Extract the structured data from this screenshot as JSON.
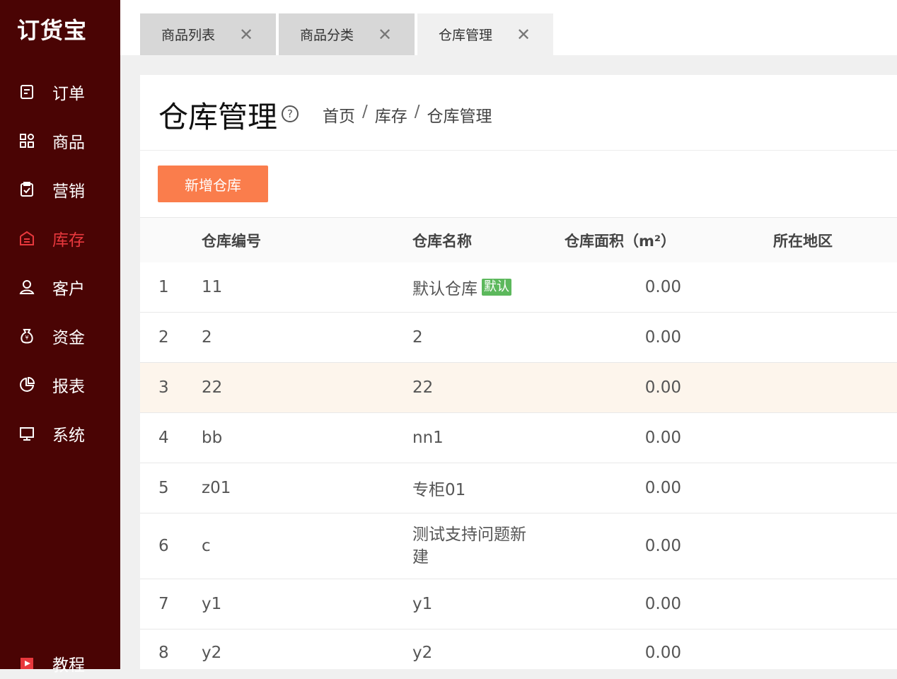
{
  "app": {
    "logo": "订货宝"
  },
  "sidebar": {
    "items": [
      {
        "label": "订单",
        "icon": "order-icon",
        "active": false
      },
      {
        "label": "商品",
        "icon": "grid-icon",
        "active": false
      },
      {
        "label": "营销",
        "icon": "clipboard-check-icon",
        "active": false
      },
      {
        "label": "库存",
        "icon": "warehouse-icon",
        "active": true
      },
      {
        "label": "客户",
        "icon": "user-icon",
        "active": false
      },
      {
        "label": "资金",
        "icon": "money-bag-icon",
        "active": false
      },
      {
        "label": "报表",
        "icon": "pie-chart-icon",
        "active": false
      },
      {
        "label": "系统",
        "icon": "monitor-icon",
        "active": false
      }
    ],
    "bottom": {
      "label": "教程",
      "icon": "play-icon"
    }
  },
  "tabs": [
    {
      "label": "商品列表",
      "active": false
    },
    {
      "label": "商品分类",
      "active": false
    },
    {
      "label": "仓库管理",
      "active": true
    }
  ],
  "page": {
    "title": "仓库管理",
    "breadcrumb": [
      "首页",
      "库存",
      "仓库管理"
    ],
    "add_button": "新增仓库"
  },
  "table": {
    "columns": [
      "",
      "仓库编号",
      "仓库名称",
      "仓库面积（m²）",
      "所在地区"
    ],
    "rows": [
      {
        "idx": "1",
        "code": "11",
        "name": "默认仓库",
        "tag": "默认",
        "area": "0.00",
        "region": ""
      },
      {
        "idx": "2",
        "code": "2",
        "name": "2",
        "area": "0.00",
        "region": ""
      },
      {
        "idx": "3",
        "code": "22",
        "name": "22",
        "area": "0.00",
        "region": ""
      },
      {
        "idx": "4",
        "code": "bb",
        "name": "nn1",
        "area": "0.00",
        "region": ""
      },
      {
        "idx": "5",
        "code": "z01",
        "name": "专柜01",
        "area": "0.00",
        "region": ""
      },
      {
        "idx": "6",
        "code": "c",
        "name": "测试支持问题新建",
        "area": "0.00",
        "region": ""
      },
      {
        "idx": "7",
        "code": "y1",
        "name": "y1",
        "area": "0.00",
        "region": ""
      },
      {
        "idx": "8",
        "code": "y2",
        "name": "y2",
        "area": "0.00",
        "region": ""
      }
    ]
  },
  "colors": {
    "sidebar_bg": "#4a0404",
    "active": "#e8383d",
    "primary_button": "#fa7d4c",
    "default_tag": "#5cb85c",
    "highlight_row": "#fdf5ec"
  }
}
